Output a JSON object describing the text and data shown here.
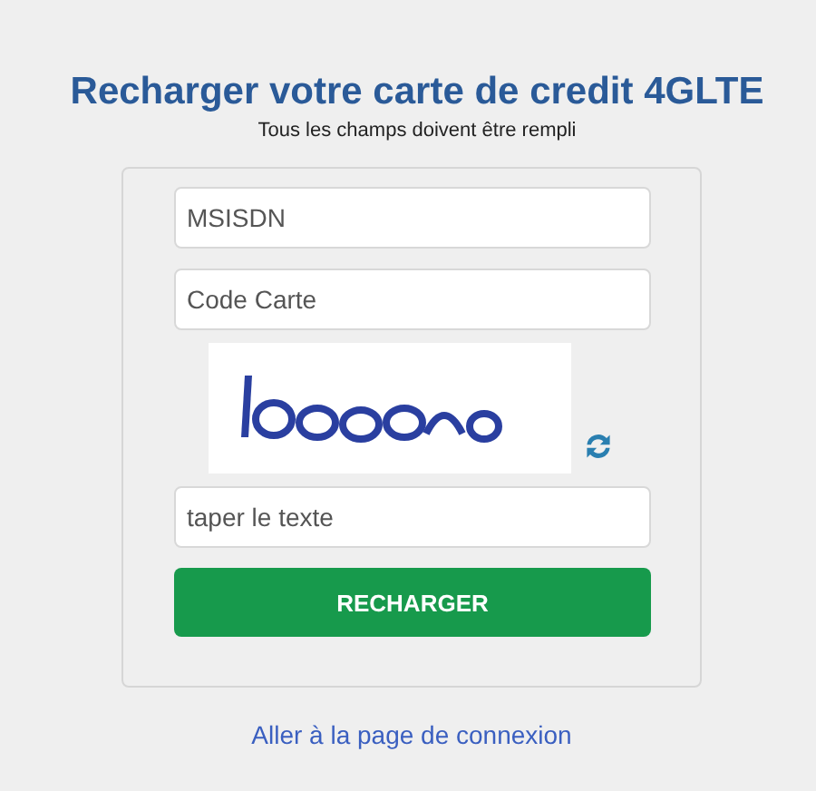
{
  "title": "Recharger votre carte de credit 4GLTE",
  "subtitle": "Tous les champs doivent être rempli",
  "fields": [
    {
      "placeholder": "MSISDN"
    },
    {
      "placeholder": "Code Carte"
    }
  ],
  "captcha_field": {
    "placeholder": "taper le texte"
  },
  "submit": "RECHARGER",
  "link": "Aller à la page de connexion"
}
